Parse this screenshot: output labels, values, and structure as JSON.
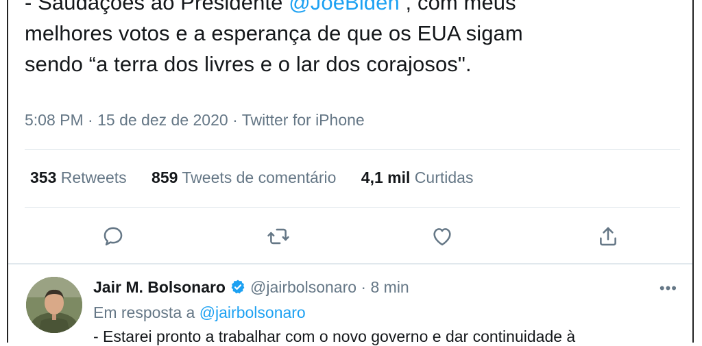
{
  "tweet": {
    "text_line1_before": "- Saudações ao Presidente ",
    "mention": "@JoeBiden",
    "text_line1_after": " , com meus",
    "text_line2": "melhores votos e a esperança de que os EUA sigam",
    "text_line3": "sendo “a terra dos livres e o lar dos corajosos\".",
    "time": "5:08 PM",
    "date": "15 de dez de 2020",
    "source": "Twitter for iPhone",
    "dot": "·"
  },
  "stats": {
    "retweets_count": "353",
    "retweets_label": "Retweets",
    "quotes_count": "859",
    "quotes_label": "Tweets de comentário",
    "likes_count": "4,1 mil",
    "likes_label": "Curtidas"
  },
  "actions": [
    "reply-icon",
    "retweet-icon",
    "like-icon",
    "share-icon"
  ],
  "reply": {
    "name": "Jair M. Bolsonaro",
    "handle": "@jairbolsonaro",
    "time": "8 min",
    "dot": "·",
    "reply_prefix": "Em resposta a",
    "reply_handle": "@jairbolsonaro",
    "text": "- Estarei pronto a trabalhar com o novo governo e dar continuidade à",
    "more": "•••"
  },
  "colors": {
    "accent": "#1da1f2",
    "muted": "#657786",
    "text": "#14171a",
    "divider": "#e1e8ed"
  }
}
